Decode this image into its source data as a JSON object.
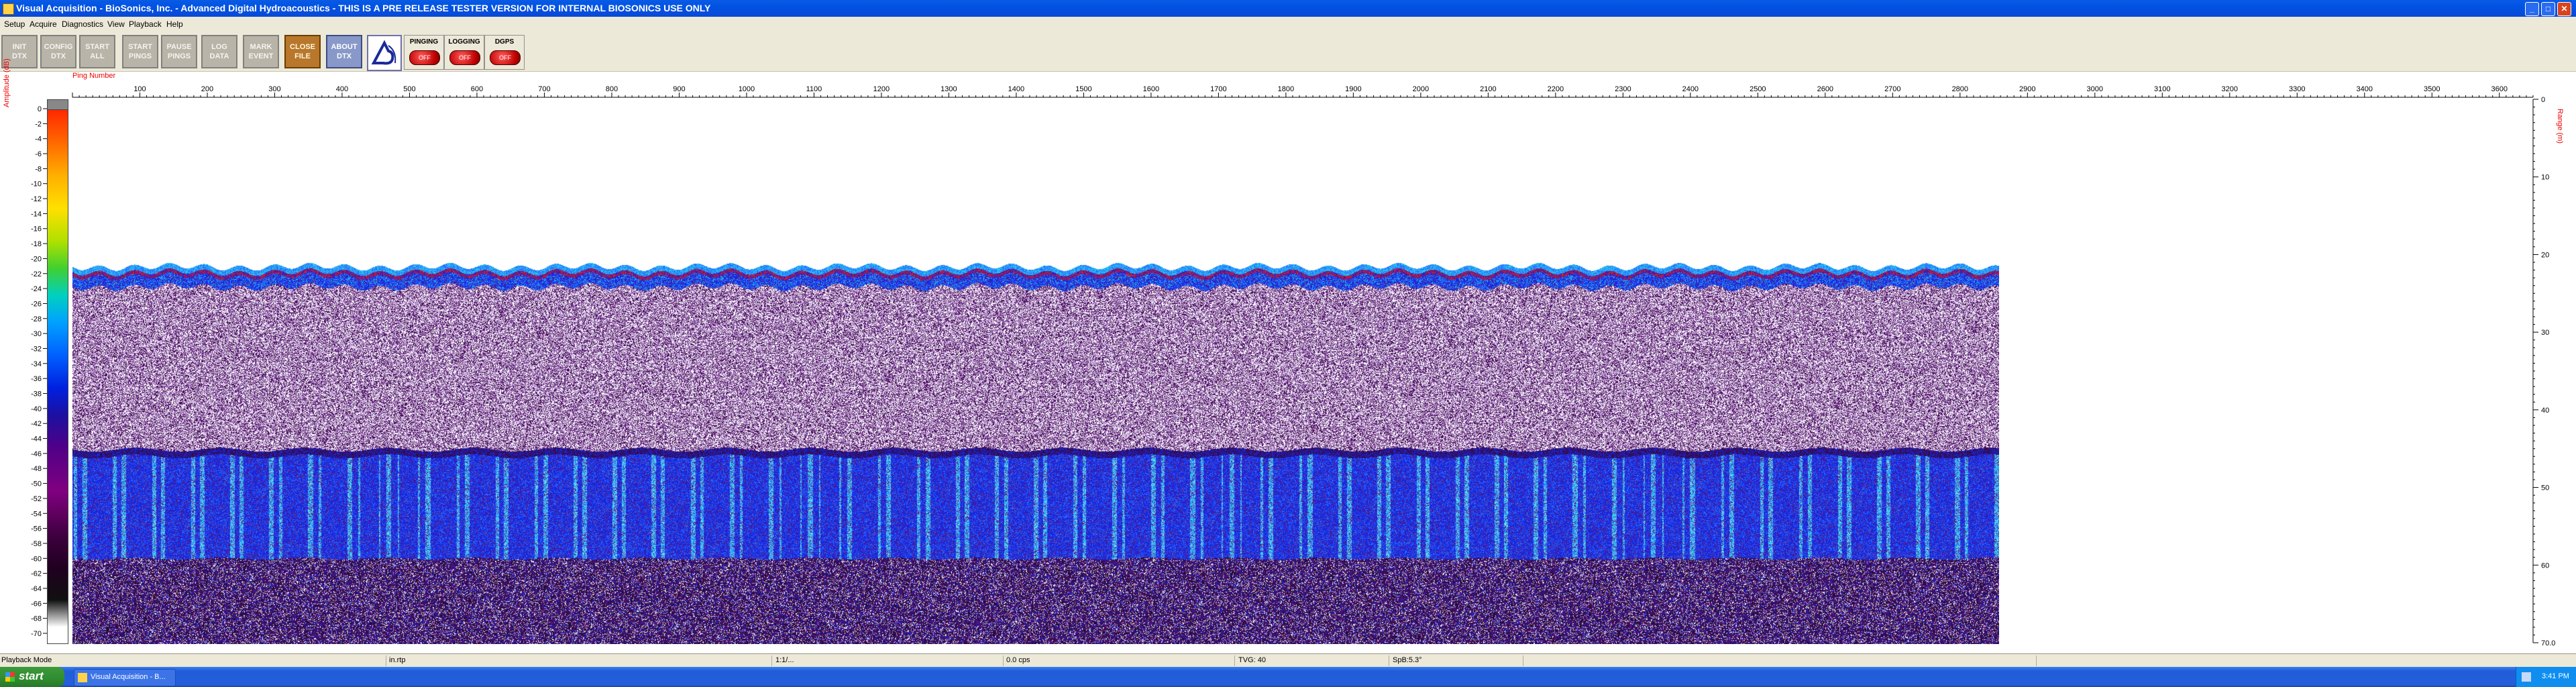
{
  "window": {
    "title": "Visual Acquisition  -  BioSonics, Inc.  -  Advanced Digital Hydroacoustics  -  THIS IS A PRE RELEASE TESTER VERSION FOR INTERNAL BIOSONICS USE ONLY",
    "minimize_glyph": "_",
    "maximize_glyph": "□",
    "close_glyph": "✕"
  },
  "menu": [
    "Setup",
    "Acquire",
    "Diagnostics",
    "View",
    "Playback",
    "Help"
  ],
  "toolbar": {
    "buttons": [
      {
        "label": "INIT\nDTX",
        "style": "normal"
      },
      {
        "label": "CONFIG\nDTX",
        "style": "normal"
      },
      {
        "label": "START\nALL",
        "style": "normal"
      },
      {
        "label": "START\nPINGS",
        "style": "normal"
      },
      {
        "label": "PAUSE\nPINGS",
        "style": "normal"
      },
      {
        "label": "LOG\nDATA",
        "style": "normal"
      },
      {
        "label": "MARK\nEVENT",
        "style": "normal"
      },
      {
        "label": "CLOSE\nFILE",
        "style": "close"
      },
      {
        "label": "ABOUT\nDTX",
        "style": "about"
      }
    ],
    "status_buttons": [
      {
        "label": "PINGING",
        "state": "OFF"
      },
      {
        "label": "LOGGING",
        "state": "OFF"
      },
      {
        "label": "DGPS",
        "state": "OFF"
      }
    ]
  },
  "echogram": {
    "ping_label": "Ping Number",
    "amplitude_label": "Amplitude (dB)",
    "range_label": "Range (m)",
    "ping_ticks": [
      100,
      200,
      300,
      400,
      500,
      600,
      700,
      800,
      900,
      1000,
      1100,
      1200,
      1300,
      1400,
      1500,
      1600,
      1700,
      1800,
      1900,
      2000,
      2100,
      2200,
      2300,
      2400,
      2500,
      2600,
      2700,
      2800,
      2900,
      3000,
      3100,
      3200,
      3300,
      3400,
      3500,
      3600
    ],
    "ping_max": 3650,
    "data_pings": 2870,
    "amplitude_ticks": [
      0,
      -2,
      -4,
      -6,
      -8,
      -10,
      -12,
      -14,
      -16,
      -18,
      -20,
      -22,
      -24,
      -26,
      -28,
      -30,
      -32,
      -34,
      -36,
      -38,
      -40,
      -42,
      -44,
      -46,
      -48,
      -50,
      -52,
      -54,
      -56,
      -58,
      -60,
      -62,
      -64,
      -66,
      -68,
      -70
    ],
    "range_ticks": [
      0,
      10,
      20,
      30,
      40,
      50,
      60
    ],
    "range_max": 70,
    "range_max_label": "70.0",
    "surface_depth_m": 21.5,
    "bottom_depth_m": 45.5
  },
  "statusbar": [
    {
      "text": "Playback Mode"
    },
    {
      "text": "in.rtp"
    },
    {
      "text": "1:1/..."
    },
    {
      "text": "0.0 cps"
    },
    {
      "text": "TVG: 40"
    },
    {
      "text": "SpB:5.3°"
    }
  ],
  "taskbar": {
    "start_label": "start",
    "task_label": "Visual Acquisition  -  B...",
    "clock": "3:41 PM"
  }
}
